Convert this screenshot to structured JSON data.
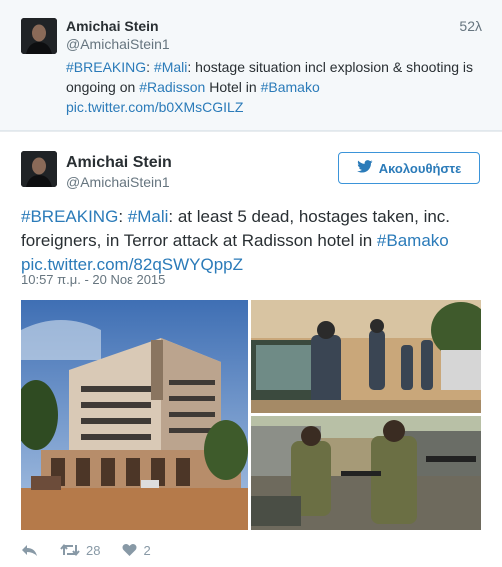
{
  "tweet_top": {
    "name": "Amichai Stein",
    "handle": "@AmichaiStein1",
    "time": "52λ",
    "text": {
      "tag1": "#BREAKING",
      "colon1": ": ",
      "tag2": "#Mali",
      "part1": ": hostage situation incl explosion & shooting is ongoing on ",
      "tag3": "#Radisson",
      "part2": " Hotel in ",
      "tag4": "#Bamako",
      "link": "pic.twitter.com/b0XMsCGILZ"
    }
  },
  "tweet_main": {
    "name": "Amichai Stein",
    "handle": "@AmichaiStein1",
    "follow_label": "Ακολουθήστε",
    "text": {
      "tag1": "#BREAKING",
      "colon1": ": ",
      "tag2": "#Mali",
      "part1": ": at least 5 dead, hostages taken, inc. foreigners, in Terror attack at Radisson hotel in ",
      "tag3": "#Bamako",
      "link": "pic.twitter.com/82qSWYQppZ"
    },
    "timestamp": "10:57 π.μ. - 20 Νοε 2015",
    "actions": {
      "retweets": "28",
      "likes": "2"
    }
  },
  "icons": {
    "follow": "twitter-bird-icon",
    "reply": "reply-icon",
    "retweet": "retweet-icon",
    "like": "heart-icon"
  },
  "colors": {
    "link": "#2b7bb9",
    "muted": "#66757f",
    "top_bg": "#f5f8fa",
    "follow_border": "#3b94d9"
  }
}
